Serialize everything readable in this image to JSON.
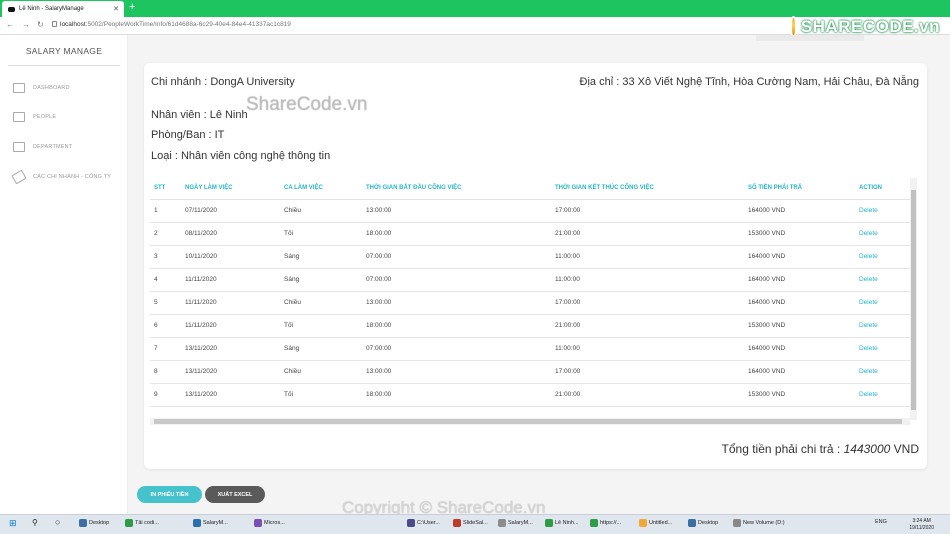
{
  "browser": {
    "tab_title": "Lê Ninh - SalaryManage",
    "url_host": "localhost",
    "url_rest": ":5002/PeopleWorkTime/Info/61d4688a-6c29-40e4-84e4-41337ac1c819"
  },
  "watermark": {
    "logo": "SHARECODE.vn",
    "middle": "ShareCode.vn",
    "copyright": "Copyright © ShareCode.vn"
  },
  "sidebar": {
    "brand": "SALARY MANAGE",
    "items": [
      {
        "label": "DASHBOARD",
        "icon": "bank-icon"
      },
      {
        "label": "PEOPLE",
        "icon": "people-icon"
      },
      {
        "label": "DEPARTMENT",
        "icon": "building-icon"
      },
      {
        "label": "CÁC CHI NHÁNH - CÔNG TY",
        "icon": "rocket-icon"
      }
    ]
  },
  "info": {
    "branch": "Chi nhánh : DongA University",
    "address": "Địa chỉ : 33 Xô Viết Nghệ Tĩnh, Hòa Cường Nam, Hải Châu, Đà Nẵng",
    "employee": "Nhân viên : Lê Ninh",
    "department": "Phòng/Ban : IT",
    "type": "Loại : Nhân viên công nghệ thông tin"
  },
  "table": {
    "headers": [
      "STT",
      "NGÀY LÀM VIỆC",
      "CA LÀM VIỆC",
      "THỜI GIAN BẮT ĐẦU CÔNG VIỆC",
      "THỜI GIAN KẾT THÚC CÔNG VIỆC",
      "SỐ TIỀN PHẢI TRẢ",
      "ACTION"
    ],
    "rows": [
      [
        "1",
        "07/11/2020",
        "Chiều",
        "13:00:00",
        "17:00:00",
        "164000 VND",
        "Delete"
      ],
      [
        "2",
        "08/11/2020",
        "Tối",
        "18:00:00",
        "21:00:00",
        "153000 VND",
        "Delete"
      ],
      [
        "3",
        "10/11/2020",
        "Sáng",
        "07:00:00",
        "11:00:00",
        "164000 VND",
        "Delete"
      ],
      [
        "4",
        "11/11/2020",
        "Sáng",
        "07:00:00",
        "11:00:00",
        "164000 VND",
        "Delete"
      ],
      [
        "5",
        "11/11/2020",
        "Chiều",
        "13:00:00",
        "17:00:00",
        "164000 VND",
        "Delete"
      ],
      [
        "6",
        "11/11/2020",
        "Tối",
        "18:00:00",
        "21:00:00",
        "153000 VND",
        "Delete"
      ],
      [
        "7",
        "13/11/2020",
        "Sáng",
        "07:00:00",
        "11:00:00",
        "164000 VND",
        "Delete"
      ],
      [
        "8",
        "13/11/2020",
        "Chiều",
        "13:00:00",
        "17:00:00",
        "164000 VND",
        "Delete"
      ],
      [
        "9",
        "13/11/2020",
        "Tối",
        "18:00:00",
        "21:00:00",
        "153000 VND",
        "Delete"
      ]
    ]
  },
  "total": {
    "label": "Tổng tiền phải chi trả : ",
    "value": "1443000",
    "unit": " VND"
  },
  "buttons": {
    "print": "IN PHIẾU TIỀN",
    "excel": "XUẤT EXCEL"
  },
  "taskbar": {
    "items": [
      "Desktop",
      "Tải codi...",
      "SalaryM...",
      "Micros...",
      "C:\\User...",
      "SlideSal...",
      "SalaryM...",
      "Lê Ninh...",
      "https://...",
      "Untitled...",
      "Desktop",
      "New Volume (D:)"
    ],
    "lang": "ENG",
    "time": "3:24 AM",
    "date": "19/11/2020"
  },
  "colors": {
    "accent": "#26b5c6",
    "chrome": "#1ec45f",
    "excel_button": "#5a5a5a"
  }
}
